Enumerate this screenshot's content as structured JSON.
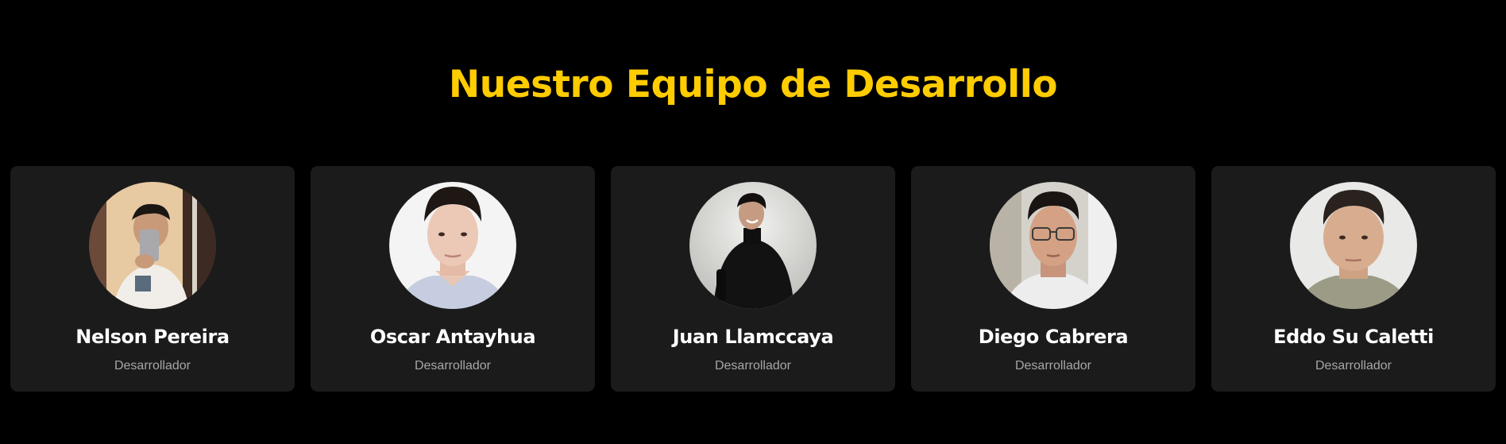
{
  "section": {
    "title": "Nuestro Equipo de Desarrollo"
  },
  "colors": {
    "background": "#000000",
    "accent": "#FFCC00",
    "card": "#1b1b1b",
    "name": "#ffffff",
    "role": "#a6a6a6"
  },
  "team": [
    {
      "name": "Nelson Pereira",
      "role": "Desarrollador",
      "photo": "mirror-selfie-photo"
    },
    {
      "name": "Oscar Antayhua",
      "role": "Desarrollador",
      "photo": "portrait-photo"
    },
    {
      "name": "Juan Llamccaya",
      "role": "Desarrollador",
      "photo": "black-sweater-photo"
    },
    {
      "name": "Diego Cabrera",
      "role": "Desarrollador",
      "photo": "glasses-portrait-photo"
    },
    {
      "name": "Eddo Su Caletti",
      "role": "Desarrollador",
      "photo": "portrait-photo"
    }
  ]
}
